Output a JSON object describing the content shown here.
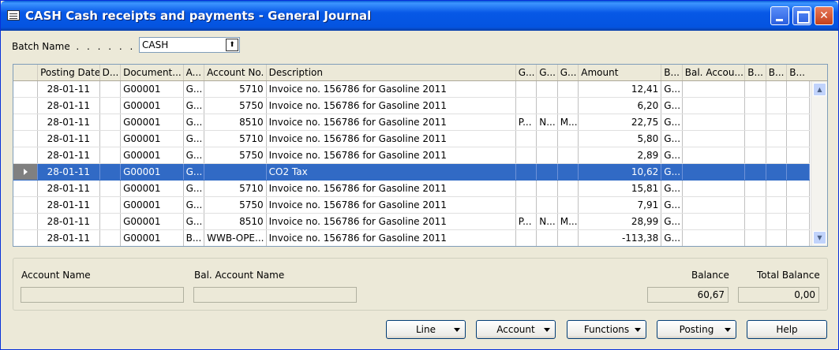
{
  "window": {
    "title": "CASH Cash receipts and payments - General Journal"
  },
  "batch": {
    "label": "Batch Name",
    "dots": ". . . . . . . .",
    "value": "CASH"
  },
  "grid": {
    "columns": [
      "Posting Date",
      "D...",
      "Document...",
      "A...",
      "Account No.",
      "Description",
      "G...",
      "G...",
      "G...",
      "Amount",
      "B...",
      "Bal. Accou...",
      "B...",
      "B...",
      "B..."
    ],
    "rows": [
      [
        "28-01-11",
        "",
        "G00001",
        "G...",
        "5710",
        "Invoice no. 156786 for Gasoline 2011",
        "",
        "",
        "",
        "12,41",
        "G...",
        "",
        "",
        "",
        ""
      ],
      [
        "28-01-11",
        "",
        "G00001",
        "G...",
        "5750",
        "Invoice no. 156786 for Gasoline 2011",
        "",
        "",
        "",
        "6,20",
        "G...",
        "",
        "",
        "",
        ""
      ],
      [
        "28-01-11",
        "",
        "G00001",
        "G...",
        "8510",
        "Invoice no. 156786 for Gasoline 2011",
        "P...",
        "N...",
        "M...",
        "22,75",
        "G...",
        "",
        "",
        "",
        ""
      ],
      [
        "28-01-11",
        "",
        "G00001",
        "G...",
        "5710",
        "Invoice no. 156786 for Gasoline 2011",
        "",
        "",
        "",
        "5,80",
        "G...",
        "",
        "",
        "",
        ""
      ],
      [
        "28-01-11",
        "",
        "G00001",
        "G...",
        "5750",
        "Invoice no. 156786 for Gasoline 2011",
        "",
        "",
        "",
        "2,89",
        "G...",
        "",
        "",
        "",
        ""
      ],
      [
        "28-01-11",
        "",
        "G00001",
        "G...",
        "",
        "CO2 Tax",
        "",
        "",
        "",
        "10,62",
        "G...",
        "",
        "",
        "",
        ""
      ],
      [
        "28-01-11",
        "",
        "G00001",
        "G...",
        "5710",
        "Invoice no. 156786 for Gasoline 2011",
        "",
        "",
        "",
        "15,81",
        "G...",
        "",
        "",
        "",
        ""
      ],
      [
        "28-01-11",
        "",
        "G00001",
        "G...",
        "5750",
        "Invoice no. 156786 for Gasoline 2011",
        "",
        "",
        "",
        "7,91",
        "G...",
        "",
        "",
        "",
        ""
      ],
      [
        "28-01-11",
        "",
        "G00001",
        "G...",
        "8510",
        "Invoice no. 156786 for Gasoline 2011",
        "P...",
        "N...",
        "M...",
        "28,99",
        "G...",
        "",
        "",
        "",
        ""
      ],
      [
        "28-01-11",
        "",
        "G00001",
        "B...",
        "WWB-OPE...",
        "Invoice no. 156786 for Gasoline 2011",
        "",
        "",
        "",
        "-113,38",
        "G...",
        "",
        "",
        "",
        ""
      ]
    ],
    "active_row": 5
  },
  "info": {
    "account_name_label": "Account Name",
    "bal_account_name_label": "Bal. Account Name",
    "balance_label": "Balance",
    "total_balance_label": "Total Balance",
    "account_name_value": "",
    "bal_account_name_value": "",
    "balance_value": "60,67",
    "total_balance_value": "0,00"
  },
  "buttons": {
    "line": "Line",
    "account": "Account",
    "functions": "Functions",
    "posting": "Posting",
    "help": "Help"
  },
  "colors": {
    "selection": "#316ac5",
    "titlebar": "#0454e0"
  }
}
